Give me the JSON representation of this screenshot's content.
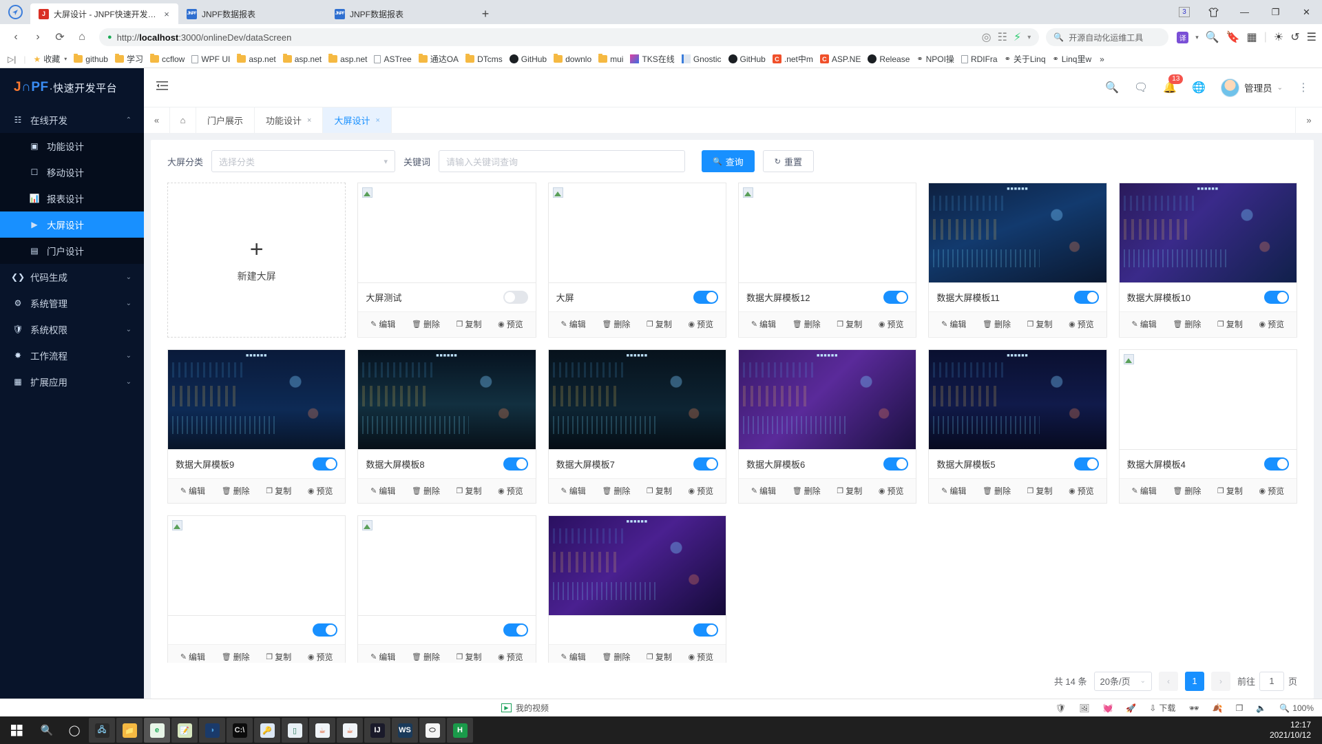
{
  "browser": {
    "tabs": [
      {
        "title": "大屏设计 - JNPF快速开发平台",
        "favicon": "jnpf-j-icon",
        "active": true,
        "close": "×"
      },
      {
        "title": "JNPF数据报表",
        "favicon": "jnpf-icon",
        "active": false,
        "close": ""
      },
      {
        "title": "JNPF数据报表",
        "favicon": "jnpf-icon",
        "active": false,
        "close": ""
      }
    ],
    "new_tab_label": "+",
    "window_controls": {
      "tab_count": "3",
      "shirt": "👕",
      "minimize": "—",
      "maximize": "❐",
      "close": "✕"
    },
    "nav": {
      "back": "‹",
      "forward": "›",
      "reload": "⟳",
      "home": "⌂"
    },
    "url": {
      "scheme": "http://",
      "host": "localhost",
      "path": ":3000/onlineDev/dataScreen",
      "shield": "🛡"
    },
    "search_placeholder": "开源自动化运维工具",
    "translate_label": "译",
    "bookmarks": [
      {
        "label": "收藏",
        "icon": "star-icon",
        "type": "star"
      },
      {
        "label": "github",
        "icon": "folder-icon",
        "type": "folder"
      },
      {
        "label": "学习",
        "icon": "folder-icon",
        "type": "folder"
      },
      {
        "label": "ccflow",
        "icon": "folder-icon",
        "type": "folder"
      },
      {
        "label": "WPF UI",
        "icon": "page-icon",
        "type": "page"
      },
      {
        "label": "asp.net",
        "icon": "folder-icon",
        "type": "folder"
      },
      {
        "label": "asp.net",
        "icon": "folder-icon",
        "type": "folder"
      },
      {
        "label": "asp.net",
        "icon": "folder-icon",
        "type": "folder"
      },
      {
        "label": "ASTree",
        "icon": "page-icon",
        "type": "page"
      },
      {
        "label": "通达OA",
        "icon": "folder-icon",
        "type": "folder"
      },
      {
        "label": "DTcms",
        "icon": "folder-icon",
        "type": "folder"
      },
      {
        "label": "GitHub",
        "icon": "github-icon",
        "type": "github"
      },
      {
        "label": "downlo",
        "icon": "folder-icon",
        "type": "folder"
      },
      {
        "label": "mui",
        "icon": "folder-icon",
        "type": "folder"
      },
      {
        "label": "TKS在线",
        "icon": "tks-icon",
        "type": "tks"
      },
      {
        "label": "Gnostic",
        "icon": "gnostic-icon",
        "type": "gnostic"
      },
      {
        "label": "GitHub",
        "icon": "github-icon",
        "type": "github"
      },
      {
        "label": ".net中m",
        "icon": "csharp-icon",
        "type": "csharp"
      },
      {
        "label": "ASP.NE",
        "icon": "csharp-icon",
        "type": "csharp"
      },
      {
        "label": "Release",
        "icon": "github-icon",
        "type": "github"
      },
      {
        "label": "NPOI操",
        "icon": "npoi-icon",
        "type": "npoi"
      },
      {
        "label": "RDIFra",
        "icon": "page-icon",
        "type": "page"
      },
      {
        "label": "关于Linq",
        "icon": "npoi-icon",
        "type": "npoi"
      },
      {
        "label": "Linq里w",
        "icon": "npoi-icon",
        "type": "npoi"
      }
    ],
    "bookmarks_overflow": "»"
  },
  "sidebar": {
    "brand": {
      "j": "J",
      "n": "∩",
      "pf": "PF",
      "rest": "·快速开发平台"
    },
    "items": [
      {
        "label": "在线开发",
        "icon": "code-window-icon",
        "chevron": "⌃",
        "level": "group"
      },
      {
        "label": "功能设计",
        "icon": "function-design-icon",
        "level": "sub"
      },
      {
        "label": "移动设计",
        "icon": "mobile-design-icon",
        "level": "sub"
      },
      {
        "label": "报表设计",
        "icon": "report-design-icon",
        "level": "sub"
      },
      {
        "label": "大屏设计",
        "icon": "screen-design-icon",
        "level": "sub",
        "active": true
      },
      {
        "label": "门户设计",
        "icon": "portal-design-icon",
        "level": "sub"
      },
      {
        "label": "代码生成",
        "icon": "code-gen-icon",
        "chevron": "⌄",
        "level": "group"
      },
      {
        "label": "系统管理",
        "icon": "gear-icon",
        "chevron": "⌄",
        "level": "group"
      },
      {
        "label": "系统权限",
        "icon": "shield-lock-icon",
        "chevron": "⌄",
        "level": "group"
      },
      {
        "label": "工作流程",
        "icon": "workflow-icon",
        "chevron": "⌄",
        "level": "group"
      },
      {
        "label": "扩展应用",
        "icon": "grid-apps-icon",
        "chevron": "⌄",
        "level": "group"
      }
    ]
  },
  "topbar": {
    "hamburger": "≡",
    "icons": [
      "search-icon",
      "message-icon",
      "bell-icon",
      "globe-icon"
    ],
    "notification_count": "13",
    "user_name": "管理员",
    "user_chevron": "⌄",
    "kebab": "⋮"
  },
  "tabbar": {
    "collapse": "«",
    "home_icon": "home-icon",
    "tabs": [
      {
        "label": "门户展示",
        "closable": false,
        "active": false
      },
      {
        "label": "功能设计",
        "closable": true,
        "active": false,
        "close": "×"
      },
      {
        "label": "大屏设计",
        "closable": true,
        "active": true,
        "close": "×"
      }
    ],
    "expand": "»"
  },
  "filter": {
    "category_label": "大屏分类",
    "category_placeholder": "选择分类",
    "keyword_label": "关键词",
    "keyword_placeholder": "请输入关键词查询",
    "search_button": "查询",
    "search_icon": "search-icon",
    "reset_button": "重置",
    "reset_icon": "refresh-icon"
  },
  "cards": {
    "new_card": {
      "label": "新建大屏",
      "plus": "+"
    },
    "actions": [
      {
        "label": "编辑",
        "icon": "edit-icon"
      },
      {
        "label": "删除",
        "icon": "trash-icon"
      },
      {
        "label": "复制",
        "icon": "copy-icon"
      },
      {
        "label": "预览",
        "icon": "eye-icon"
      }
    ],
    "items": [
      {
        "title": "大屏测试",
        "enabled": false,
        "thumb": "blank"
      },
      {
        "title": "大屏",
        "enabled": true,
        "thumb": "blank"
      },
      {
        "title": "数据大屏模板12",
        "enabled": true,
        "thumb": "blank"
      },
      {
        "title": "数据大屏模板11",
        "enabled": true,
        "thumb": "tpl11"
      },
      {
        "title": "数据大屏模板10",
        "enabled": true,
        "thumb": "tpl10"
      },
      {
        "title": "数据大屏模板9",
        "enabled": true,
        "thumb": "tpl9"
      },
      {
        "title": "数据大屏模板8",
        "enabled": true,
        "thumb": "tpl8"
      },
      {
        "title": "数据大屏模板7",
        "enabled": true,
        "thumb": "tpl7"
      },
      {
        "title": "数据大屏模板6",
        "enabled": true,
        "thumb": "tpl6"
      },
      {
        "title": "数据大屏模板5",
        "enabled": true,
        "thumb": "tpl5"
      },
      {
        "title": "数据大屏模板4",
        "enabled": true,
        "thumb": "blank"
      },
      {
        "title": "",
        "enabled": true,
        "thumb": "blank"
      },
      {
        "title": "",
        "enabled": true,
        "thumb": "blank"
      },
      {
        "title": "",
        "enabled": true,
        "thumb": "tpl3"
      }
    ]
  },
  "pagination": {
    "total": "共 14 条",
    "page_size": "20条/页",
    "page_size_chevron": "⌄",
    "prev": "‹",
    "next": "›",
    "current_page": "1",
    "jump_label": "前往",
    "jump_value": "1",
    "jump_suffix": "页"
  },
  "statusbar": {
    "my_video": "我的视频",
    "download": "下载",
    "zoom": "100%",
    "icons": [
      "shield-icon",
      "image-icon",
      "heart-icon",
      "rocket-icon",
      "download-icon",
      "incognito-icon",
      "leaf-icon",
      "window-icon",
      "speaker-icon",
      "zoom-icon"
    ]
  },
  "taskbar": {
    "start": "windows-icon",
    "search": "search-icon",
    "cortana": "cortana-icon",
    "apps": [
      {
        "name": "server-icon",
        "glyph": "🖧",
        "bg": "#2a2a2a",
        "color": "#7fc4e8"
      },
      {
        "name": "explorer-icon",
        "glyph": "📁",
        "bg": "#f5b942",
        "color": "#fff"
      },
      {
        "name": "360-browser-icon",
        "glyph": "e",
        "bg": "#e8f5e8",
        "color": "#1aaa55"
      },
      {
        "name": "notepad-icon",
        "glyph": "📝",
        "bg": "#d8e8c0",
        "color": "#333"
      },
      {
        "name": "navicat-icon",
        "glyph": "◑",
        "bg": "#1a3a6a",
        "color": "#4aa0e0"
      },
      {
        "name": "cmd-icon",
        "glyph": "C:\\",
        "bg": "#0c0c0c",
        "color": "#ddd"
      },
      {
        "name": "keepass-icon",
        "glyph": "🔑",
        "bg": "#dce8f5",
        "color": "#2a5a9a"
      },
      {
        "name": "app-icon",
        "glyph": "▯",
        "bg": "#e8f0f5",
        "color": "#2a7a5a"
      },
      {
        "name": "java-icon",
        "glyph": "☕",
        "bg": "#f0f4f8",
        "color": "#e05a2a"
      },
      {
        "name": "java-icon",
        "glyph": "☕",
        "bg": "#f0f4f8",
        "color": "#e05a2a"
      },
      {
        "name": "intellij-icon",
        "glyph": "IJ",
        "bg": "#1a1a2a",
        "color": "#fff"
      },
      {
        "name": "webstorm-icon",
        "glyph": "WS",
        "bg": "#1a3a5a",
        "color": "#fff"
      },
      {
        "name": "ellipse-app-icon",
        "glyph": "⬭",
        "bg": "#f5f5f5",
        "color": "#333"
      },
      {
        "name": "h-app-icon",
        "glyph": "H",
        "bg": "#1a9a4a",
        "color": "#fff"
      }
    ],
    "clock_time": "12:17",
    "clock_date": "2021/10/12"
  },
  "colors": {
    "accent": "#1890ff",
    "sidebar_bg": "#08142a",
    "sidebar_sub_bg": "#050d1c",
    "badge_red": "#f5544c"
  }
}
